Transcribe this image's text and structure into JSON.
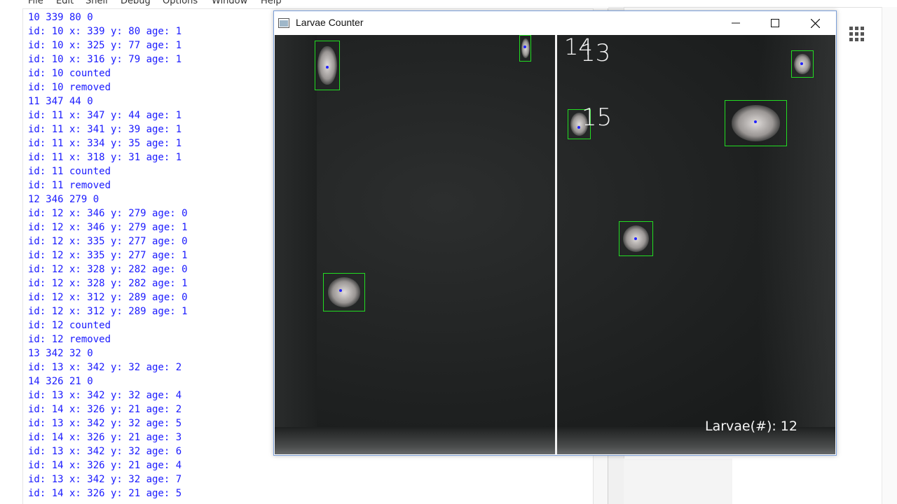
{
  "shell": {
    "menu": [
      "File",
      "Edit",
      "Shell",
      "Debug",
      "Options",
      "Window",
      "Help"
    ],
    "lines": [
      "10 339 80 0",
      "id: 10 x: 339 y: 80 age: 1",
      "id: 10 x: 325 y: 77 age: 1",
      "id: 10 x: 316 y: 79 age: 1",
      "id: 10 counted",
      "id: 10 removed",
      "11 347 44 0",
      "id: 11 x: 347 y: 44 age: 1",
      "id: 11 x: 341 y: 39 age: 1",
      "id: 11 x: 334 y: 35 age: 1",
      "id: 11 x: 318 y: 31 age: 1",
      "id: 11 counted",
      "id: 11 removed",
      "12 346 279 0",
      "id: 12 x: 346 y: 279 age: 0",
      "id: 12 x: 346 y: 279 age: 1",
      "id: 12 x: 335 y: 277 age: 0",
      "id: 12 x: 335 y: 277 age: 1",
      "id: 12 x: 328 y: 282 age: 0",
      "id: 12 x: 328 y: 282 age: 1",
      "id: 12 x: 312 y: 289 age: 0",
      "id: 12 x: 312 y: 289 age: 1",
      "id: 12 counted",
      "id: 12 removed",
      "13 342 32 0",
      "id: 13 x: 342 y: 32 age: 2",
      "14 326 21 0",
      "id: 13 x: 342 y: 32 age: 4",
      "id: 14 x: 326 y: 21 age: 2",
      "id: 13 x: 342 y: 32 age: 5",
      "id: 14 x: 326 y: 21 age: 3",
      "id: 13 x: 342 y: 32 age: 6",
      "id: 14 x: 326 y: 21 age: 4",
      "id: 13 x: 342 y: 32 age: 7",
      "id: 14 x: 326 y: 21 age: 5"
    ]
  },
  "larvae_window": {
    "title": "Larvae Counter",
    "icons": {
      "app": "window-app-icon",
      "minimize": "minimize-icon",
      "maximize": "maximize-icon",
      "close": "close-icon"
    },
    "track_labels": {
      "label_14": "14",
      "label_13": "13",
      "label_15": "15"
    },
    "counter_text": "Larvae(#): 12",
    "colors": {
      "box": "#22dd22",
      "centroid": "#2222ff",
      "divider": "#f2f2f2"
    }
  },
  "background_window": {
    "icons": {
      "grid": "grid-menu-icon"
    }
  }
}
